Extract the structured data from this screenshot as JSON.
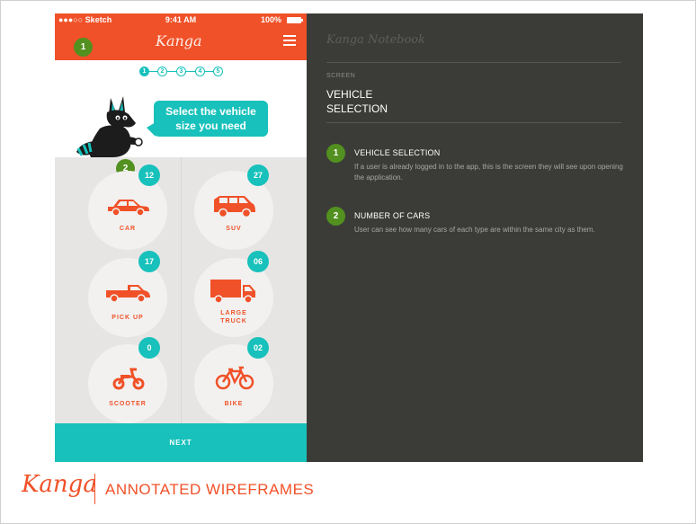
{
  "status_bar": {
    "carrier": "●●●○○ Sketch",
    "time": "9:41 AM",
    "battery": "100%"
  },
  "app": {
    "logo": "Kanga",
    "progress_steps": [
      "1",
      "2",
      "3",
      "4",
      "5"
    ],
    "active_step": 1,
    "bubble_line1": "Select the vehicle",
    "bubble_line2": "size you need",
    "next_label": "NEXT",
    "vehicles": [
      {
        "label": "CAR",
        "count": "12",
        "icon": "car-icon"
      },
      {
        "label": "SUV",
        "count": "27",
        "icon": "suv-icon"
      },
      {
        "label": "PICK UP",
        "count": "17",
        "icon": "pickup-icon"
      },
      {
        "label_line1": "LARGE",
        "label_line2": "TRUCK",
        "count": "06",
        "icon": "truck-icon"
      },
      {
        "label": "SCOOTER",
        "count": "0",
        "icon": "scooter-icon"
      },
      {
        "label": "BIKE",
        "count": "02",
        "icon": "bike-icon"
      }
    ]
  },
  "markers": {
    "one": "1",
    "two": "2"
  },
  "notebook": {
    "title": "Kanga Notebook",
    "screen_label": "SCREEN",
    "screen_title_line1": "VEHICLE",
    "screen_title_line2": "SELECTION",
    "notes": [
      {
        "number": "1",
        "title": "VEHICLE SELECTION",
        "body": "If a user is already logged in to the app, this is the screen they will see upon opening the application."
      },
      {
        "number": "2",
        "title": "NUMBER OF CARS",
        "body": "User can see how many cars of each type are within the same city as them."
      }
    ]
  },
  "footer": {
    "logo": "Kanga",
    "title": "ANNOTATED WIREFRAMES"
  },
  "colors": {
    "brand_orange": "#f05128",
    "teal": "#18c1bb",
    "marker_green": "#52901f",
    "notebook_bg": "#3b3c38"
  }
}
